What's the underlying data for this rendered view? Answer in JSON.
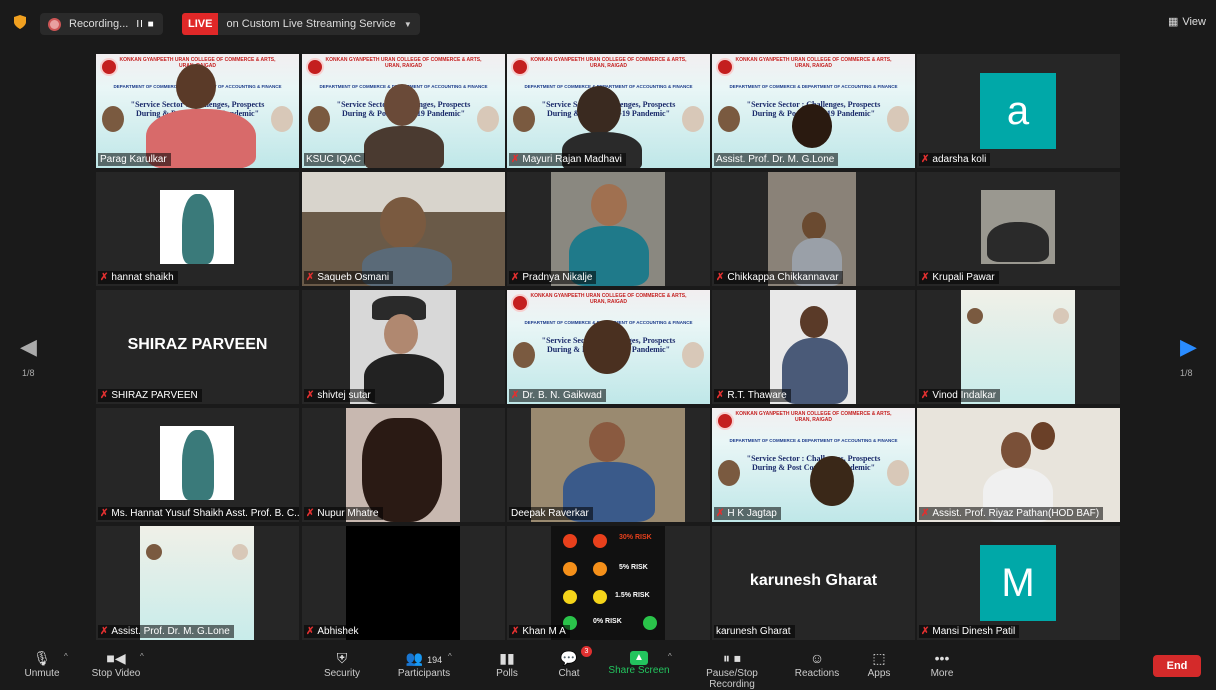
{
  "topbar": {
    "recording_label": "Recording...",
    "recording_controls": "II ■",
    "live_badge": "LIVE",
    "live_service": "on Custom Live Streaming Service",
    "view_label": "View"
  },
  "navigation": {
    "left_page": "1/8",
    "right_page": "1/8"
  },
  "poster": {
    "college": "KONKAN GYANPEETH URAN COLLEGE OF COMMERCE & ARTS, URAN, RAIGAD",
    "dept": "DEPARTMENT OF COMMERCE & DEPARTMENT OF ACCOUNTING & FINANCE",
    "title": "\"Service Sector : Challenges, Prospects During & Post Covid-19 Pandemic\""
  },
  "participants": [
    {
      "name": "Parag Karulkar",
      "muted": false
    },
    {
      "name": "KSUC IQAC",
      "muted": false
    },
    {
      "name": "Mayuri Rajan Madhavi",
      "muted": true
    },
    {
      "name": "Assist. Prof. Dr. M. G.Lone",
      "muted": false
    },
    {
      "name": "adarsha koli",
      "muted": true,
      "initial": "a"
    },
    {
      "name": "hannat shaikh",
      "muted": true
    },
    {
      "name": "Saqueb Osmani",
      "muted": true
    },
    {
      "name": "Pradnya Nikalje",
      "muted": true
    },
    {
      "name": "Chikkappa Chikkannavar",
      "muted": true
    },
    {
      "name": "Krupali Pawar",
      "muted": true
    },
    {
      "name": "SHIRAZ PARVEEN",
      "muted": true,
      "display": "SHIRAZ PARVEEN"
    },
    {
      "name": "shivtej sutar",
      "muted": true
    },
    {
      "name": "Dr. B. N. Gaikwad",
      "muted": true
    },
    {
      "name": "R.T. Thaware",
      "muted": true
    },
    {
      "name": "Vinod Indalkar",
      "muted": true
    },
    {
      "name": "Ms. Hannat Yusuf Shaikh Asst. Prof. B. C...",
      "muted": true
    },
    {
      "name": "Nupur Mhatre",
      "muted": true
    },
    {
      "name": "Deepak Raverkar",
      "muted": false
    },
    {
      "name": "H K Jagtap",
      "muted": true
    },
    {
      "name": "Assist. Prof. Riyaz Pathan(HOD BAF)",
      "muted": true
    },
    {
      "name": "Assist. Prof. Dr. M. G.Lone",
      "muted": true
    },
    {
      "name": "Abhishek",
      "muted": true
    },
    {
      "name": "Khan M A",
      "muted": true
    },
    {
      "name": "karunesh Gharat",
      "muted": false,
      "display": "karunesh Gharat"
    },
    {
      "name": "Mansi Dinesh Patil",
      "muted": true,
      "initial": "M"
    }
  ],
  "risk_chart": {
    "labels": [
      "30% RISK",
      "5% RISK",
      "1.5% RISK",
      "0% RISK"
    ]
  },
  "toolbar": {
    "unmute": "Unmute",
    "stop_video": "Stop Video",
    "security": "Security",
    "participants": "Participants",
    "participants_count": "194",
    "polls": "Polls",
    "chat": "Chat",
    "chat_badge": "3",
    "share_screen": "Share Screen",
    "pause_recording": "Pause/Stop Recording",
    "reactions": "Reactions",
    "apps": "Apps",
    "more": "More",
    "end": "End"
  },
  "colors": {
    "live_red": "#e02828",
    "share_green": "#23c45e",
    "avatar_teal": "#00a8a8",
    "active_speaker": "#c8e04a"
  }
}
